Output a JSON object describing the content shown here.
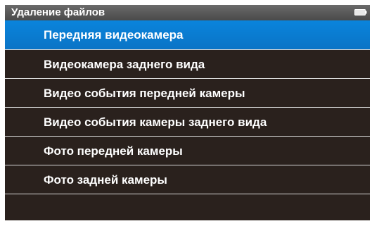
{
  "header": {
    "title": "Удаление файлов",
    "icon": "battery-icon"
  },
  "menu": {
    "selected_index": 0,
    "items": [
      {
        "label": "Передняя видеокамера"
      },
      {
        "label": "Видеокамера заднего вида"
      },
      {
        "label": "Видео события передней камеры"
      },
      {
        "label": "Видео события камеры заднего вида"
      },
      {
        "label": "Фото передней камеры"
      },
      {
        "label": "Фото задней камеры"
      }
    ]
  },
  "colors": {
    "screen_bg": "#2a211d",
    "header_bg": "#5a5a5a",
    "selection": "#0a7ed4",
    "divider": "#d8d8d8",
    "text": "#ffffff"
  }
}
